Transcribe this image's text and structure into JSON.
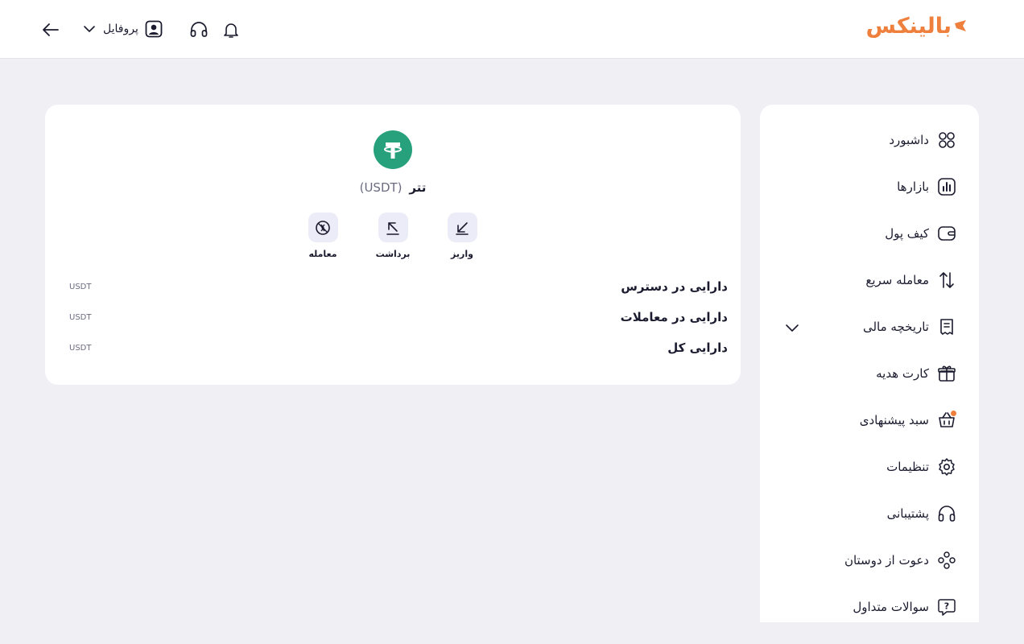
{
  "header": {
    "logo_text": "بالینکس",
    "profile_label": "پروفایل",
    "icons": {
      "back": "arrow-left-icon",
      "profile_chevron": "chevron-down-icon",
      "profile_avatar": "user-avatar-icon",
      "support": "headset-icon",
      "notifications": "bell-icon"
    }
  },
  "sidebar": {
    "items": [
      {
        "label": "داشبورد",
        "icon": "dashboard-grid-icon"
      },
      {
        "label": "بازارها",
        "icon": "markets-chart-icon"
      },
      {
        "label": "کیف پول",
        "icon": "wallet-icon"
      },
      {
        "label": "معامله سریع",
        "icon": "swap-arrows-icon"
      },
      {
        "label": "تاریخچه مالی",
        "icon": "receipt-icon"
      },
      {
        "label": "کارت هدیه",
        "icon": "gift-icon"
      },
      {
        "label": "سبد پیشنهادی",
        "icon": "basket-icon"
      },
      {
        "label": "تنظیمات",
        "icon": "gear-icon"
      },
      {
        "label": "پشتیبانی",
        "icon": "headset-icon"
      },
      {
        "label": "دعوت از دوستان",
        "icon": "people-icon"
      },
      {
        "label": "سوالات متداول",
        "icon": "question-chat-icon"
      }
    ]
  },
  "coin": {
    "name": "تتر",
    "symbol": "(USDT)",
    "icon": "tether-logo-icon",
    "brand_color": "#26a17b"
  },
  "actions": [
    {
      "label": "واریز",
      "icon": "deposit-arrow-icon"
    },
    {
      "label": "برداشت",
      "icon": "withdraw-arrow-icon"
    },
    {
      "label": "معامله",
      "icon": "trade-coin-icon"
    }
  ],
  "balances": [
    {
      "label": "دارایی در دسترس",
      "unit": "USDT"
    },
    {
      "label": "دارایی در معاملات",
      "unit": "USDT"
    },
    {
      "label": "دارایی کل",
      "unit": "USDT"
    }
  ],
  "colors": {
    "accent": "#ee7f3c",
    "background": "#efeff4",
    "action_bg": "#ececf8"
  }
}
